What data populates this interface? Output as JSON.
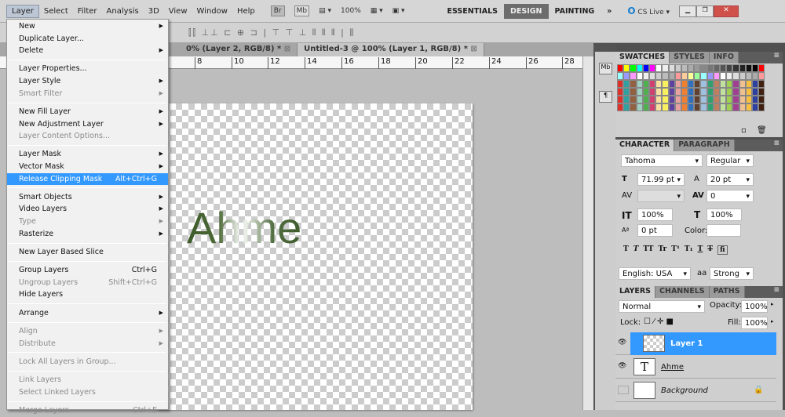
{
  "menubar": {
    "items": [
      "Layer",
      "Select",
      "Filter",
      "Analysis",
      "3D",
      "View",
      "Window",
      "Help"
    ],
    "br": "Br",
    "mb": "Mb",
    "zoom": "100%",
    "workspaces": [
      "ESSENTIALS",
      "DESIGN",
      "PAINTING"
    ],
    "more": "»",
    "cslive": "CS Live ▾"
  },
  "doc_tabs": [
    "%",
    "0% (Layer 2, RGB/8) *",
    "Untitled-3 @ 100% (Layer 1, RGB/8) *"
  ],
  "ruler": [
    "8",
    "10",
    "12",
    "14",
    "16",
    "18",
    "20",
    "22",
    "24",
    "26",
    "28"
  ],
  "canvas_text": "Ahme",
  "layer_menu": [
    {
      "label": "New",
      "arrow": true
    },
    {
      "label": "Duplicate Layer..."
    },
    {
      "label": "Delete",
      "arrow": true
    },
    {
      "sep": true
    },
    {
      "label": "Layer Properties..."
    },
    {
      "label": "Layer Style",
      "arrow": true
    },
    {
      "label": "Smart Filter",
      "disabled": true,
      "arrow": true
    },
    {
      "sep": true
    },
    {
      "label": "New Fill Layer",
      "arrow": true
    },
    {
      "label": "New Adjustment Layer",
      "arrow": true
    },
    {
      "label": "Layer Content Options...",
      "disabled": true
    },
    {
      "sep": true
    },
    {
      "label": "Layer Mask",
      "arrow": true
    },
    {
      "label": "Vector Mask",
      "arrow": true
    },
    {
      "label": "Release Clipping Mask",
      "shortcut": "Alt+Ctrl+G",
      "highlight": true
    },
    {
      "sep": true
    },
    {
      "label": "Smart Objects",
      "arrow": true
    },
    {
      "label": "Video Layers",
      "arrow": true
    },
    {
      "label": "Type",
      "disabled": true,
      "arrow": true
    },
    {
      "label": "Rasterize",
      "arrow": true
    },
    {
      "sep": true
    },
    {
      "label": "New Layer Based Slice"
    },
    {
      "sep": true
    },
    {
      "label": "Group Layers",
      "shortcut": "Ctrl+G"
    },
    {
      "label": "Ungroup Layers",
      "shortcut": "Shift+Ctrl+G",
      "disabled": true
    },
    {
      "label": "Hide Layers"
    },
    {
      "sep": true
    },
    {
      "label": "Arrange",
      "arrow": true
    },
    {
      "sep": true
    },
    {
      "label": "Align",
      "disabled": true,
      "arrow": true
    },
    {
      "label": "Distribute",
      "disabled": true,
      "arrow": true
    },
    {
      "sep": true
    },
    {
      "label": "Lock All Layers in Group...",
      "disabled": true
    },
    {
      "sep": true
    },
    {
      "label": "Link Layers",
      "disabled": true
    },
    {
      "label": "Select Linked Layers",
      "disabled": true
    },
    {
      "sep": true
    },
    {
      "label": "Merge Layers",
      "shortcut": "Ctrl+E",
      "disabled": true
    }
  ],
  "swatches": {
    "tabs": [
      "SWATCHES",
      "STYLES",
      "INFO"
    ]
  },
  "character": {
    "tabs": [
      "CHARACTER",
      "PARAGRAPH"
    ],
    "font": "Tahoma",
    "style": "Regular",
    "size": "71.99 pt",
    "leading": "20 pt",
    "kerning": "",
    "tracking": "0",
    "vscale": "100%",
    "hscale": "100%",
    "baseline": "0 pt",
    "color_label": "Color:",
    "language": "English: USA",
    "aa": "Strong",
    "aa_icon": "aa",
    "type_buttons": [
      "T",
      "T",
      "TT",
      "Tr",
      "T¹",
      "T₁",
      "T",
      "T",
      "fi"
    ]
  },
  "layers": {
    "tabs": [
      "LAYERS",
      "CHANNELS",
      "PATHS"
    ],
    "blend": "Normal",
    "opacity_label": "Opacity:",
    "opacity": "100%",
    "lock_label": "Lock:",
    "fill_label": "Fill:",
    "fill": "100%",
    "items": [
      {
        "name": "Layer 1",
        "visible": true,
        "selected": true
      },
      {
        "name": "Ahme",
        "visible": true,
        "type": "T"
      },
      {
        "name": "Background",
        "visible": false,
        "locked": true
      }
    ]
  }
}
